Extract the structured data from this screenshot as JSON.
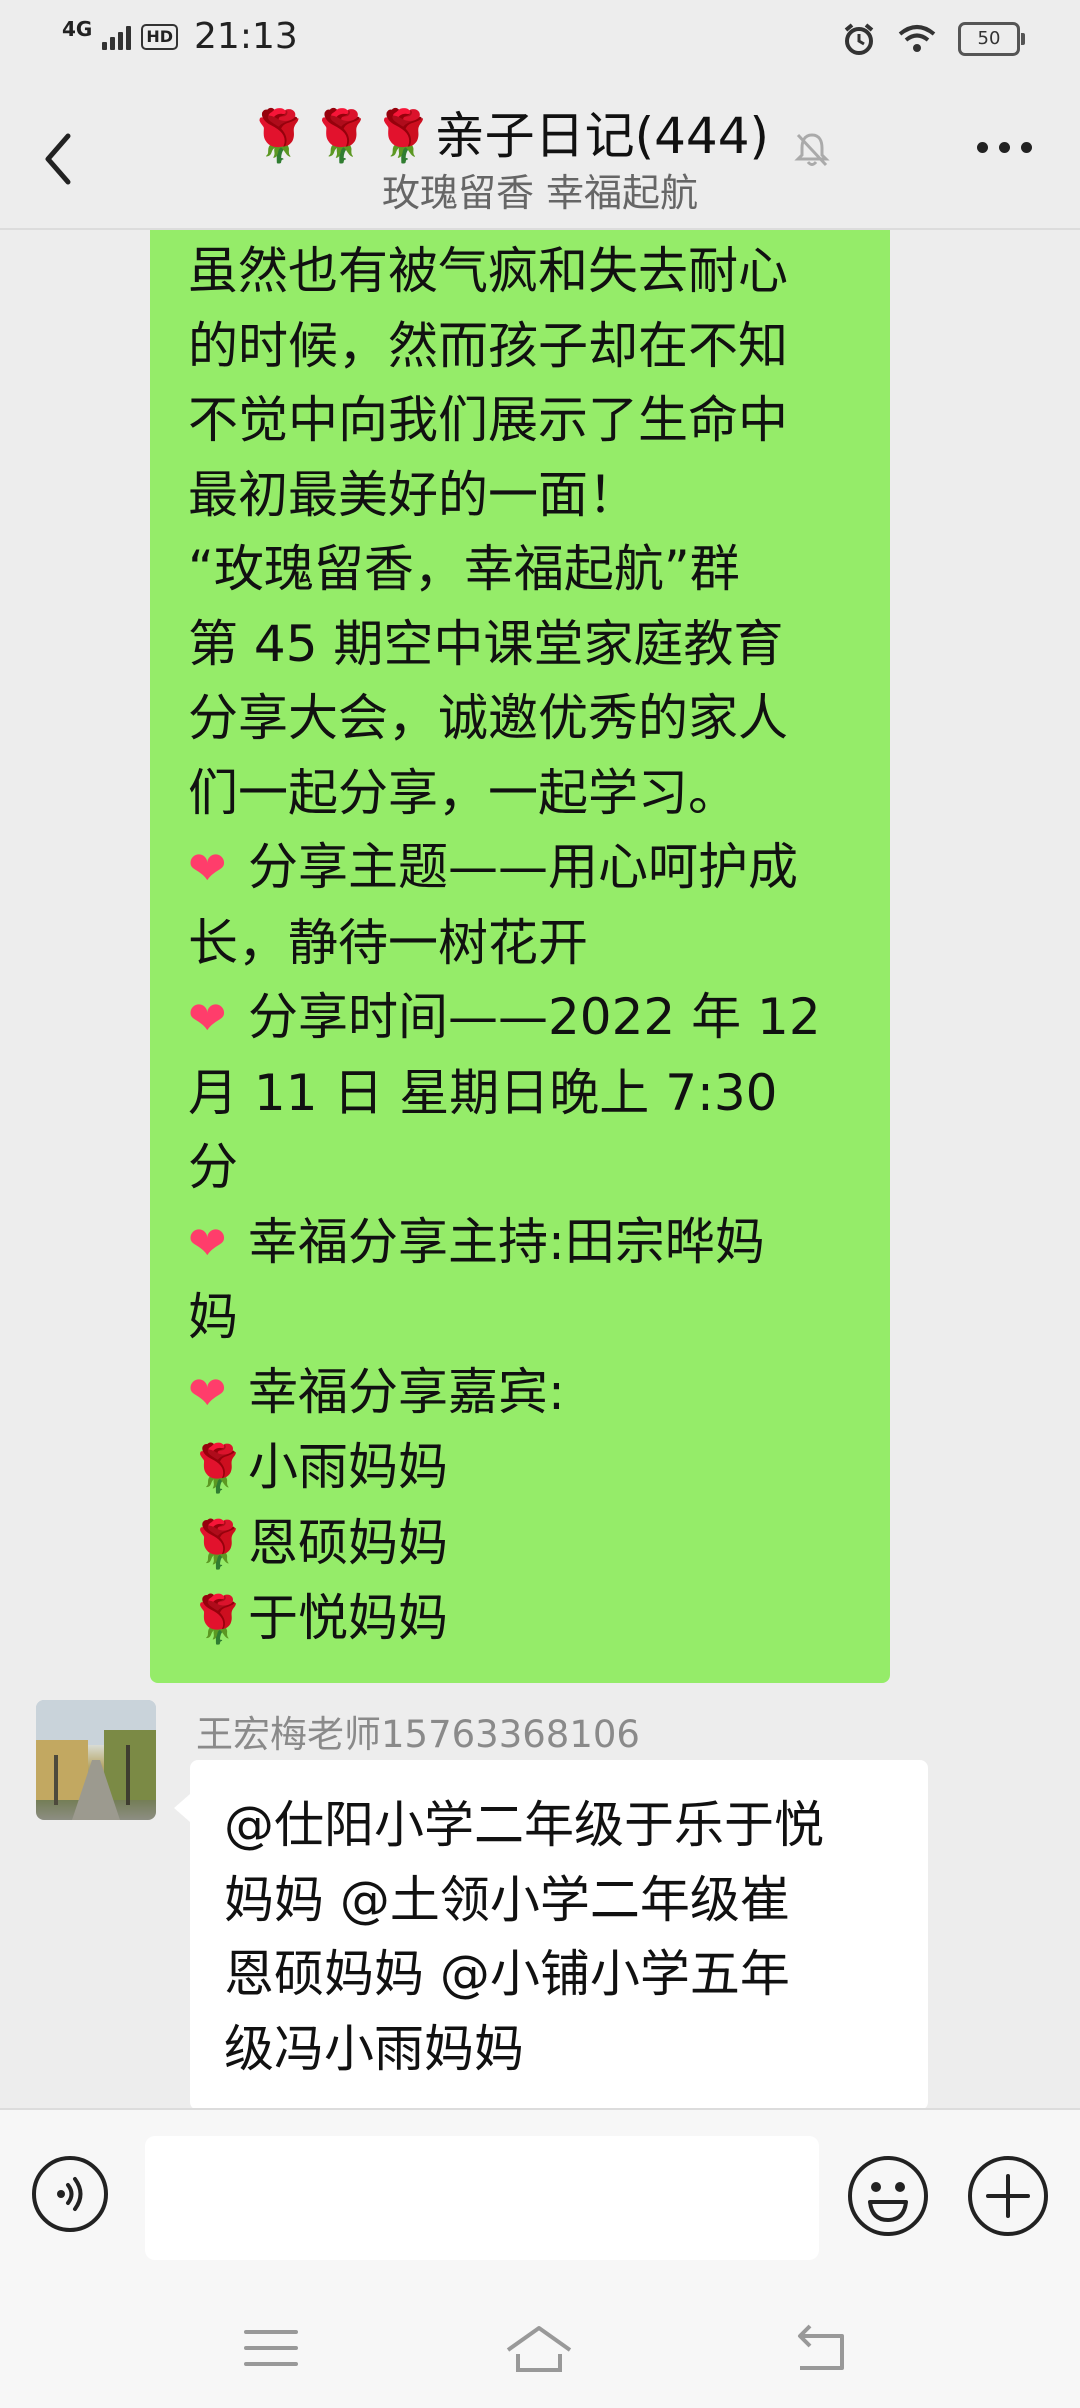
{
  "status_bar": {
    "network": "4G",
    "hd_label": "HD",
    "time": "21:13",
    "battery": "50"
  },
  "header": {
    "title": "🌹🌹🌹亲子日记(444)",
    "subtitle": "玫瑰留香  幸福起航"
  },
  "messages": {
    "outgoing": {
      "line1": "虽然也有被气疯和失去耐心",
      "line2": "的时候，然而孩子却在不知",
      "line3": "不觉中向我们展示了生命中",
      "line4": "最初最美好的一面！",
      "line5": "“玫瑰留香，幸福起航”群",
      "line6": "第 45 期空中课堂家庭教育",
      "line7": "分享大会，诚邀优秀的家人",
      "line8": "们一起分享，一起学习。",
      "theme_1": "分享主题——用心呵护成",
      "theme_2": "长，静待一树花开",
      "time_1": "分享时间——2022 年 12",
      "time_2": "月 11 日  星期日晚上 7:30",
      "time_3": "分",
      "host_1": "幸福分享主持:田宗晔妈",
      "host_2": "妈",
      "guests_title": "幸福分享嘉宾:",
      "guests": [
        "小雨妈妈",
        "恩硕妈妈",
        "于悦妈妈"
      ]
    },
    "incoming": {
      "sender": "王宏梅老师15763368106",
      "line1": "@仕阳小学二年级于乐于悦",
      "line2": "妈妈  @土领小学二年级崔",
      "line3": "恩硕妈妈  @小铺小学五年",
      "line4": "级冯小雨妈妈"
    }
  },
  "icons": {
    "heart": "❤",
    "rose": "🌹"
  },
  "colors": {
    "outgoing_bubble": "#95ec69",
    "incoming_bubble": "#ffffff",
    "background": "#ededed"
  }
}
